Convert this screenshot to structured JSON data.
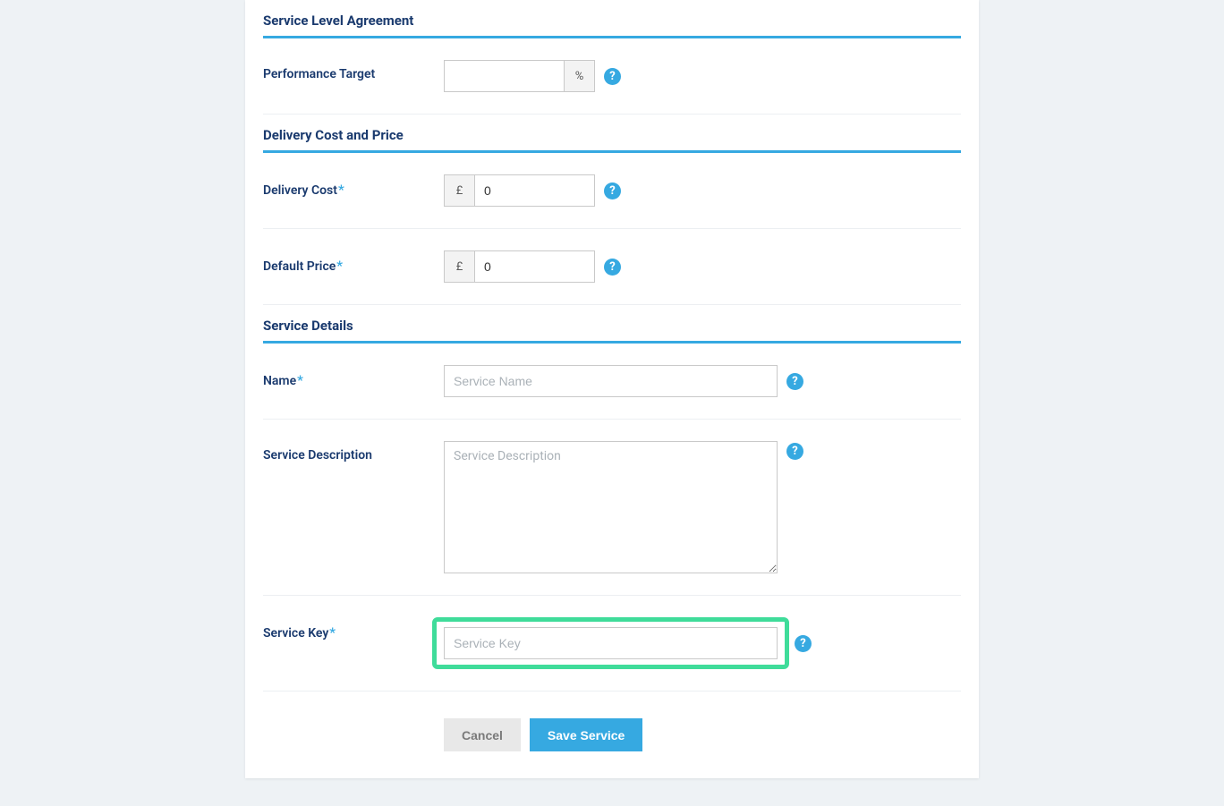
{
  "sections": {
    "sla_title": "Service Level Agreement",
    "delivery_title": "Delivery Cost and Price",
    "details_title": "Service Details"
  },
  "labels": {
    "performance_target": "Performance Target",
    "delivery_cost": "Delivery Cost",
    "default_price": "Default Price",
    "name": "Name",
    "service_description": "Service Description",
    "service_key": "Service Key"
  },
  "addons": {
    "percent": "%",
    "pound": "£"
  },
  "values": {
    "performance_target": "",
    "delivery_cost": "0",
    "default_price": "0",
    "name": "",
    "service_description": "",
    "service_key": ""
  },
  "placeholders": {
    "name": "Service Name",
    "service_description": "Service Description",
    "service_key": "Service Key"
  },
  "help_glyph": "?",
  "buttons": {
    "cancel": "Cancel",
    "save": "Save Service"
  }
}
